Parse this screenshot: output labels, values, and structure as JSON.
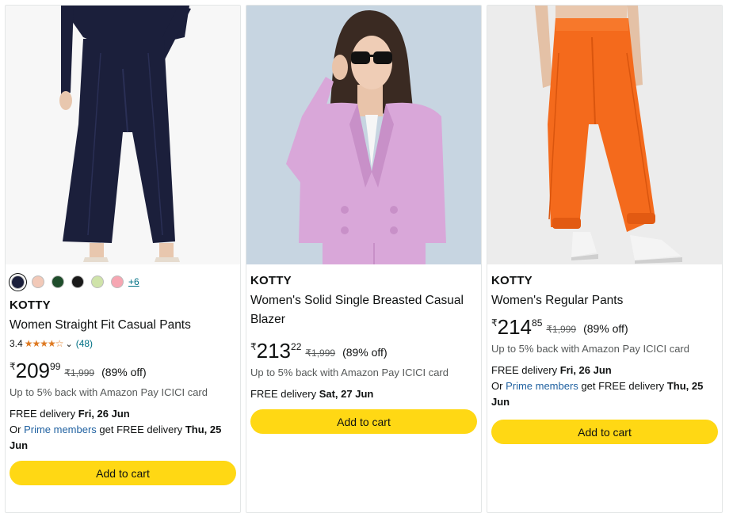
{
  "products": [
    {
      "brand": "KOTTY",
      "title": "Women Straight Fit Casual Pants",
      "rating": "3.4",
      "review_count": "(48)",
      "currency": "₹",
      "price_whole": "209",
      "price_fraction": "99",
      "mrp": "₹1,999",
      "discount": "(89% off)",
      "cashback": "Up to 5% back with Amazon Pay ICICI card",
      "delivery_prefix": "FREE delivery ",
      "delivery_date": "Fri, 26 Jun",
      "prime_prefix": "Or ",
      "prime_link": "Prime members",
      "prime_mid": " get FREE delivery ",
      "prime_date": "Thu, 25 Jun",
      "more_colors": "+6",
      "swatches": [
        "#1b1f3b",
        "#f2c9b8",
        "#1f4d2b",
        "#1a1a1a",
        "#cfe3a9",
        "#f6a6b2"
      ],
      "add_to_cart": "Add to cart",
      "image_alt": "navy wide-leg pants"
    },
    {
      "brand": "KOTTY",
      "title": "Women's Solid Single Breasted Casual Blazer",
      "currency": "₹",
      "price_whole": "213",
      "price_fraction": "22",
      "mrp": "₹1,999",
      "discount": "(89% off)",
      "cashback": "Up to 5% back with Amazon Pay ICICI card",
      "delivery_prefix": "FREE delivery ",
      "delivery_date": "Sat, 27 Jun",
      "add_to_cart": "Add to cart",
      "image_alt": "pink blazer with sunglasses"
    },
    {
      "brand": "KOTTY",
      "title": "Women's Regular Pants",
      "currency": "₹",
      "price_whole": "214",
      "price_fraction": "85",
      "mrp": "₹1,999",
      "discount": "(89% off)",
      "cashback": "Up to 5% back with Amazon Pay ICICI card",
      "delivery_prefix": "FREE delivery ",
      "delivery_date": "Fri, 26 Jun",
      "prime_prefix": "Or ",
      "prime_link": "Prime members",
      "prime_mid": " get FREE delivery ",
      "prime_date": "Thu, 25 Jun",
      "add_to_cart": "Add to cart",
      "image_alt": "orange cargo joggers"
    }
  ],
  "colors": {
    "button": "#ffd814",
    "link": "#2162a1",
    "star": "#de7921",
    "muted": "#565959"
  },
  "icons": [
    "star-icon",
    "chevron-down-icon"
  ]
}
